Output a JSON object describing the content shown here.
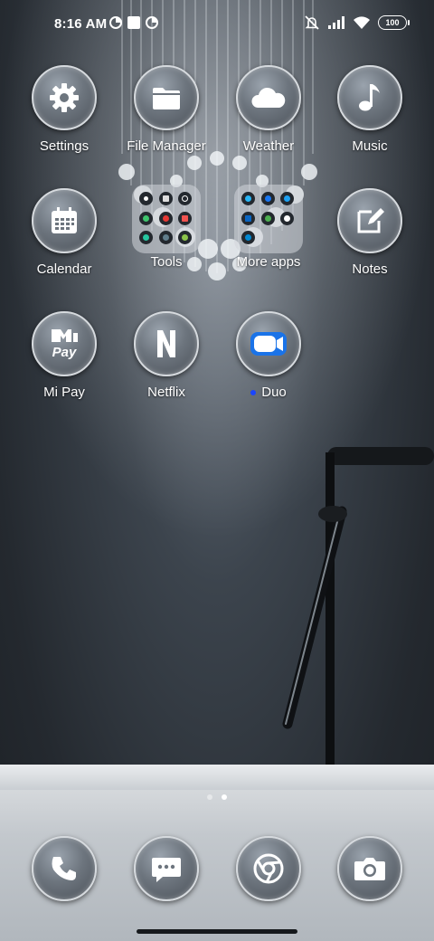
{
  "status_bar": {
    "time": "8:16 AM",
    "left_icons": [
      "pie-icon",
      "square-notification-icon",
      "pie-icon"
    ],
    "right_icons": [
      "mute-icon",
      "signal-icon",
      "wifi-icon"
    ],
    "battery": "100"
  },
  "apps": [
    {
      "label": "Settings",
      "icon": "gear-icon"
    },
    {
      "label": "File Manager",
      "icon": "folder-icon"
    },
    {
      "label": "Weather",
      "icon": "cloud-icon"
    },
    {
      "label": "Music",
      "icon": "music-note-icon"
    },
    {
      "label": "Calendar",
      "icon": "calendar-icon"
    },
    {
      "label": "Tools",
      "icon": "folder-tools"
    },
    {
      "label": "More apps",
      "icon": "folder-more-apps"
    },
    {
      "label": "Notes",
      "icon": "notes-icon"
    },
    {
      "label": "Mi Pay",
      "icon": "mi-pay-icon",
      "logo_text": "MI Pay"
    },
    {
      "label": "Netflix",
      "icon": "netflix-icon",
      "logo_text": "N"
    },
    {
      "label": "Duo",
      "icon": "video-camera-icon",
      "badge": "new-app-dot"
    }
  ],
  "dock": [
    {
      "icon": "phone-icon"
    },
    {
      "icon": "messages-icon"
    },
    {
      "icon": "chrome-icon"
    },
    {
      "icon": "camera-icon"
    }
  ],
  "page_indicator": {
    "pages": 2,
    "current": 2
  },
  "colors": {
    "duo_badge": "#1a45ff",
    "duo_blue": "#1a73e8"
  }
}
